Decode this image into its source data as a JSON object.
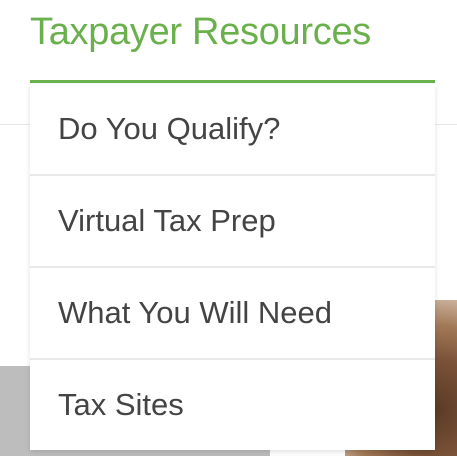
{
  "heading": {
    "title": "Taxpayer Resources",
    "accent_color": "#6ab04c"
  },
  "menu": {
    "items": [
      {
        "label": "Do You Qualify?"
      },
      {
        "label": "Virtual Tax Prep"
      },
      {
        "label": "What You Will Need"
      },
      {
        "label": "Tax Sites"
      }
    ]
  }
}
